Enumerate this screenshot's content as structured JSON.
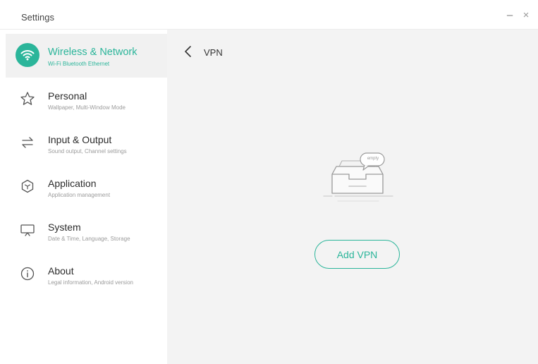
{
  "window": {
    "title": "Settings",
    "minimize_label": "–",
    "close_label": "×"
  },
  "sidebar": {
    "items": [
      {
        "label": "Wireless & Network",
        "sub": "Wi-Fi Bluetooth Ethernet",
        "icon": "wifi-icon",
        "active": true
      },
      {
        "label": "Personal",
        "sub": "Wallpaper, Multi-Window Mode",
        "icon": "star-icon",
        "active": false
      },
      {
        "label": "Input & Output",
        "sub": "Sound output, Channel settings",
        "icon": "swap-arrows-icon",
        "active": false
      },
      {
        "label": "Application",
        "sub": "Application management",
        "icon": "hexagon-app-icon",
        "active": false
      },
      {
        "label": "System",
        "sub": "Date & Time, Language, Storage",
        "icon": "monitor-icon",
        "active": false
      },
      {
        "label": "About",
        "sub": "Legal information, Android version",
        "icon": "info-icon",
        "active": false
      }
    ]
  },
  "main": {
    "page_title": "VPN",
    "empty_label": "empty",
    "add_button": "Add VPN"
  },
  "colors": {
    "accent": "#2bb59a",
    "content_bg": "#f3f3f3",
    "active_item_bg": "#f1f1f1"
  }
}
